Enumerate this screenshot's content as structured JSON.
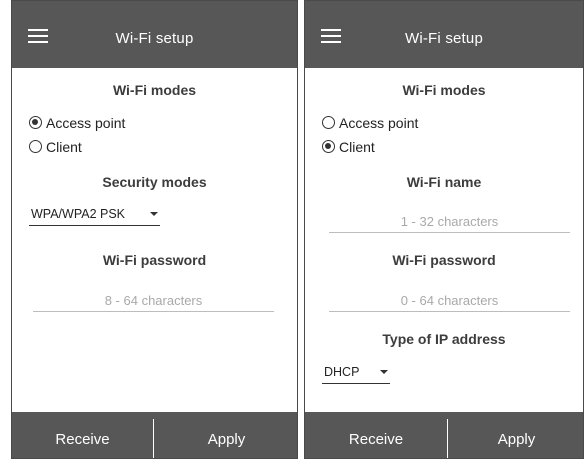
{
  "left_panel": {
    "header": {
      "title": "Wi-Fi setup",
      "menu_icon": "hamburger-menu-icon"
    },
    "wifi_modes": {
      "title": "Wi-Fi modes",
      "options": [
        {
          "label": "Access point",
          "checked": true
        },
        {
          "label": "Client",
          "checked": false
        }
      ]
    },
    "security_modes": {
      "title": "Security modes",
      "selected": "WPA/WPA2 PSK"
    },
    "wifi_password": {
      "title": "Wi-Fi password",
      "value": "",
      "placeholder": "8 - 64 characters"
    },
    "footer": {
      "receive_label": "Receive",
      "apply_label": "Apply"
    }
  },
  "right_panel": {
    "header": {
      "title": "Wi-Fi setup",
      "menu_icon": "hamburger-menu-icon"
    },
    "wifi_modes": {
      "title": "Wi-Fi modes",
      "options": [
        {
          "label": "Access point",
          "checked": false
        },
        {
          "label": "Client",
          "checked": true
        }
      ]
    },
    "wifi_name": {
      "title": "Wi-Fi name",
      "value": "",
      "placeholder": "1 - 32 characters"
    },
    "wifi_password": {
      "title": "Wi-Fi password",
      "value": "",
      "placeholder": "0 - 64 characters"
    },
    "ip_type": {
      "title": "Type of IP address",
      "selected": "DHCP"
    },
    "footer": {
      "receive_label": "Receive",
      "apply_label": "Apply"
    }
  },
  "colors": {
    "bar_background": "#575757",
    "bar_text": "#ffffff",
    "panel_background": "#ffffff",
    "placeholder_text": "#a9a9a9"
  }
}
